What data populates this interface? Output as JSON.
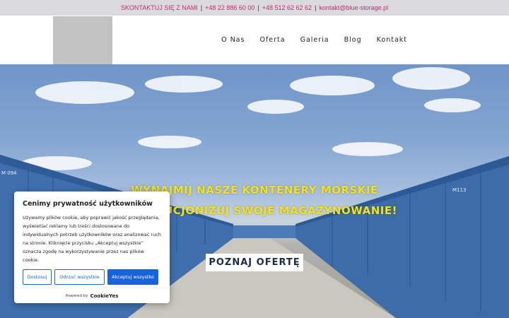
{
  "topbar": {
    "label": "SKONTAKTUJ SIĘ Z NAMI",
    "phone1": "+48 22 886 60 00",
    "phone2": "+48 512 62 62 62",
    "email": "kontakt@blue-storage.pl",
    "separator": "|"
  },
  "nav": {
    "items": [
      "O Nas",
      "Oferta",
      "Galeria",
      "Blog",
      "Kontakt"
    ]
  },
  "hero": {
    "line1": "WYNAJMIJ NASZE KONTENERY MORSKIE",
    "line2": "ZREWOLUCJONIZUJ SWOJE MAGAZYNOWANIE!",
    "cta": "POZNAJ OFERTĘ",
    "container_marks": [
      "M 094",
      "M113"
    ]
  },
  "cookie": {
    "title": "Cenimy prywatność użytkowników",
    "body": "Używamy plików cookie, aby poprawić jakość przeglądania, wyświetlać reklamy lub treści dostosowane do indywidualnych potrzeb użytkowników oraz analizować ruch na stronie. Kliknięcie przycisku „Akceptuj wszystkie” oznacza zgodę na wykorzystywanie przez nas plików cookie.",
    "customize": "Dostosuj",
    "reject": "Odrzuć wszystkie",
    "accept": "Akceptuj wszystko",
    "powered_by": "Powered by",
    "brand": "CookieYes"
  },
  "colors": {
    "accent_pink": "#c0306b",
    "hero_yellow": "#f1e21b",
    "button_blue": "#1863dc"
  }
}
